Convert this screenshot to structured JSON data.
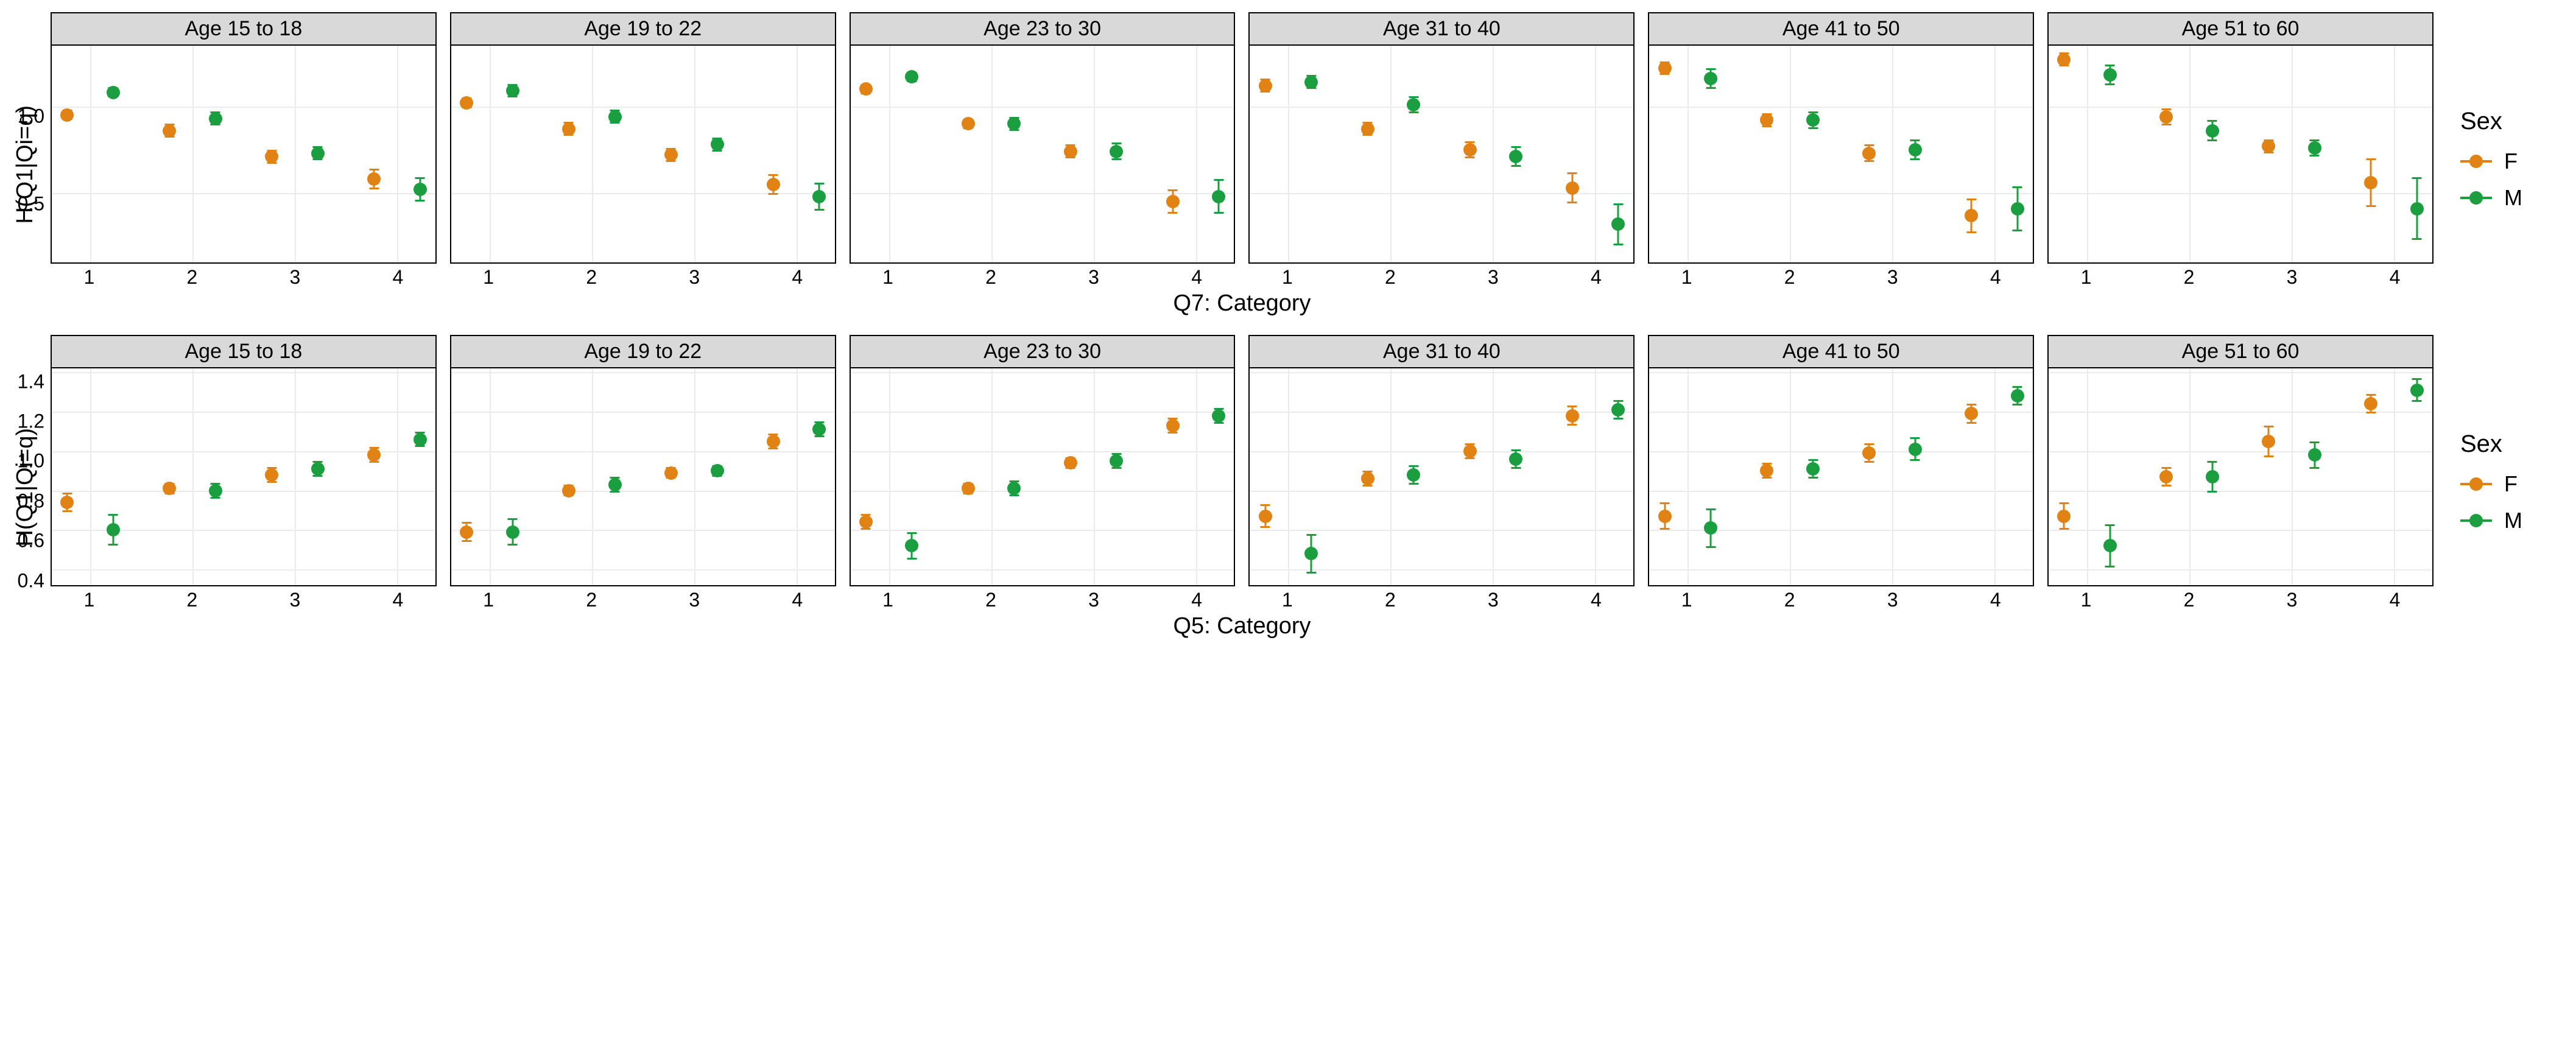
{
  "legend": {
    "title": "Sex",
    "items": [
      {
        "key": "F",
        "label": "F",
        "color": "#e08214"
      },
      {
        "key": "M",
        "label": "M",
        "color": "#1b9e3f"
      }
    ]
  },
  "dodge": 0.06,
  "chart_data": [
    {
      "id": "row-q7",
      "xlabel": "Q7: Category",
      "ylabel": "H(Q1|Qi=q)",
      "x": [
        1,
        2,
        3,
        4
      ],
      "ylim": [
        0.1,
        1.35
      ],
      "yticks": [
        0.5,
        1.0
      ],
      "facets": [
        {
          "label": "Age 15 to 18",
          "series": [
            {
              "name": "F",
              "values": [
                0.95,
                0.86,
                0.71,
                0.58
              ],
              "err": [
                0.03,
                0.04,
                0.04,
                0.06
              ]
            },
            {
              "name": "M",
              "values": [
                1.08,
                0.93,
                0.73,
                0.52
              ],
              "err": [
                0.03,
                0.04,
                0.04,
                0.07
              ]
            }
          ]
        },
        {
          "label": "Age 19 to 22",
          "series": [
            {
              "name": "F",
              "values": [
                1.02,
                0.87,
                0.72,
                0.55
              ],
              "err": [
                0.03,
                0.04,
                0.04,
                0.06
              ]
            },
            {
              "name": "M",
              "values": [
                1.09,
                0.94,
                0.78,
                0.48
              ],
              "err": [
                0.04,
                0.04,
                0.04,
                0.08
              ]
            }
          ]
        },
        {
          "label": "Age 23 to 30",
          "series": [
            {
              "name": "F",
              "values": [
                1.1,
                0.9,
                0.74,
                0.45
              ],
              "err": [
                0.03,
                0.03,
                0.04,
                0.07
              ]
            },
            {
              "name": "M",
              "values": [
                1.17,
                0.9,
                0.74,
                0.48
              ],
              "err": [
                0.03,
                0.04,
                0.05,
                0.1
              ]
            }
          ]
        },
        {
          "label": "Age 31 to 40",
          "series": [
            {
              "name": "F",
              "values": [
                1.12,
                0.87,
                0.75,
                0.53
              ],
              "err": [
                0.04,
                0.04,
                0.05,
                0.09
              ]
            },
            {
              "name": "M",
              "values": [
                1.14,
                1.01,
                0.71,
                0.32
              ],
              "err": [
                0.04,
                0.05,
                0.06,
                0.12
              ]
            }
          ]
        },
        {
          "label": "Age 41 to 50",
          "series": [
            {
              "name": "F",
              "values": [
                1.22,
                0.92,
                0.73,
                0.37
              ],
              "err": [
                0.04,
                0.04,
                0.05,
                0.1
              ]
            },
            {
              "name": "M",
              "values": [
                1.16,
                0.92,
                0.75,
                0.41
              ],
              "err": [
                0.06,
                0.05,
                0.06,
                0.13
              ]
            }
          ]
        },
        {
          "label": "Age 51 to 60",
          "series": [
            {
              "name": "F",
              "values": [
                1.27,
                0.94,
                0.77,
                0.56
              ],
              "err": [
                0.04,
                0.05,
                0.04,
                0.14
              ]
            },
            {
              "name": "M",
              "values": [
                1.18,
                0.86,
                0.76,
                0.41
              ],
              "err": [
                0.06,
                0.06,
                0.05,
                0.18
              ]
            }
          ]
        }
      ]
    },
    {
      "id": "row-q5",
      "xlabel": "Q5: Category",
      "ylabel": "H(Q1|Qi=q)",
      "x": [
        1,
        2,
        3,
        4
      ],
      "ylim": [
        0.32,
        1.42
      ],
      "yticks": [
        0.4,
        0.6,
        0.8,
        1.0,
        1.2,
        1.4
      ],
      "facets": [
        {
          "label": "Age 15 to 18",
          "series": [
            {
              "name": "F",
              "values": [
                0.74,
                0.81,
                0.88,
                0.98
              ],
              "err": [
                0.05,
                0.03,
                0.04,
                0.04
              ]
            },
            {
              "name": "M",
              "values": [
                0.6,
                0.8,
                0.91,
                1.06
              ],
              "err": [
                0.08,
                0.04,
                0.04,
                0.04
              ]
            }
          ]
        },
        {
          "label": "Age 19 to 22",
          "series": [
            {
              "name": "F",
              "values": [
                0.59,
                0.8,
                0.89,
                1.05
              ],
              "err": [
                0.05,
                0.03,
                0.03,
                0.04
              ]
            },
            {
              "name": "M",
              "values": [
                0.59,
                0.83,
                0.9,
                1.11
              ],
              "err": [
                0.07,
                0.04,
                0.03,
                0.04
              ]
            }
          ]
        },
        {
          "label": "Age 23 to 30",
          "series": [
            {
              "name": "F",
              "values": [
                0.64,
                0.81,
                0.94,
                1.13
              ],
              "err": [
                0.04,
                0.03,
                0.03,
                0.04
              ]
            },
            {
              "name": "M",
              "values": [
                0.52,
                0.81,
                0.95,
                1.18
              ],
              "err": [
                0.07,
                0.04,
                0.04,
                0.04
              ]
            }
          ]
        },
        {
          "label": "Age 31 to 40",
          "series": [
            {
              "name": "F",
              "values": [
                0.67,
                0.86,
                1.0,
                1.18
              ],
              "err": [
                0.06,
                0.04,
                0.04,
                0.05
              ]
            },
            {
              "name": "M",
              "values": [
                0.48,
                0.88,
                0.96,
                1.21
              ],
              "err": [
                0.1,
                0.05,
                0.05,
                0.05
              ]
            }
          ]
        },
        {
          "label": "Age 41 to 50",
          "series": [
            {
              "name": "F",
              "values": [
                0.67,
                0.9,
                0.99,
                1.19
              ],
              "err": [
                0.07,
                0.04,
                0.05,
                0.05
              ]
            },
            {
              "name": "M",
              "values": [
                0.61,
                0.91,
                1.01,
                1.28
              ],
              "err": [
                0.1,
                0.05,
                0.06,
                0.05
              ]
            }
          ]
        },
        {
          "label": "Age 51 to 60",
          "series": [
            {
              "name": "F",
              "values": [
                0.67,
                0.87,
                1.05,
                1.24
              ],
              "err": [
                0.07,
                0.05,
                0.08,
                0.05
              ]
            },
            {
              "name": "M",
              "values": [
                0.52,
                0.87,
                0.98,
                1.31
              ],
              "err": [
                0.11,
                0.08,
                0.07,
                0.06
              ]
            }
          ]
        }
      ]
    }
  ]
}
